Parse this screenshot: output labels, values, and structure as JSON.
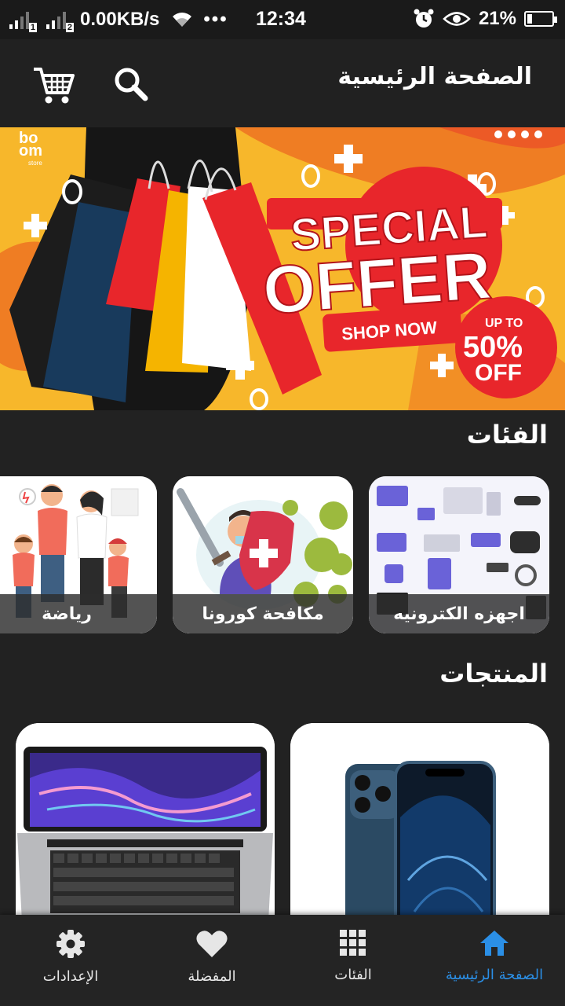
{
  "status_bar": {
    "sim1": "1",
    "sim2": "2",
    "speed": "0.00KB/s",
    "dots": "•••",
    "time": "12:34",
    "battery": "21%"
  },
  "app_bar": {
    "title": "الصفحة الرئيسية",
    "icons": [
      "cart-icon",
      "search-icon"
    ]
  },
  "banner": {
    "brand_top": "bo",
    "brand_bottom": "om",
    "brand_sub": "store",
    "headline_1": "SPECIAL",
    "headline_2": "OFFER",
    "cta": "SHOP NOW",
    "badge_top": "UP TO",
    "badge_value": "50%",
    "badge_bottom": "OFF",
    "colors": {
      "background": "#f7b72b",
      "accent": "#e8262b"
    }
  },
  "categories": {
    "title": "الفئات",
    "items": [
      {
        "label": "اجهزه الكترونيه"
      },
      {
        "label": "مكافحة كورونا"
      },
      {
        "label": "رياضة"
      }
    ]
  },
  "products": {
    "title": "المنتجات",
    "items": [
      {
        "image": "smartphone"
      },
      {
        "image": "laptop"
      }
    ]
  },
  "bottom_nav": {
    "items": [
      {
        "label": "الصفحة الرئيسية",
        "icon": "home-icon",
        "active": true
      },
      {
        "label": "الفئات",
        "icon": "grid-icon",
        "active": false
      },
      {
        "label": "المفضلة",
        "icon": "heart-icon",
        "active": false
      },
      {
        "label": "الإعدادات",
        "icon": "gear-icon",
        "active": false
      }
    ],
    "active_color": "#2b8fe6"
  }
}
